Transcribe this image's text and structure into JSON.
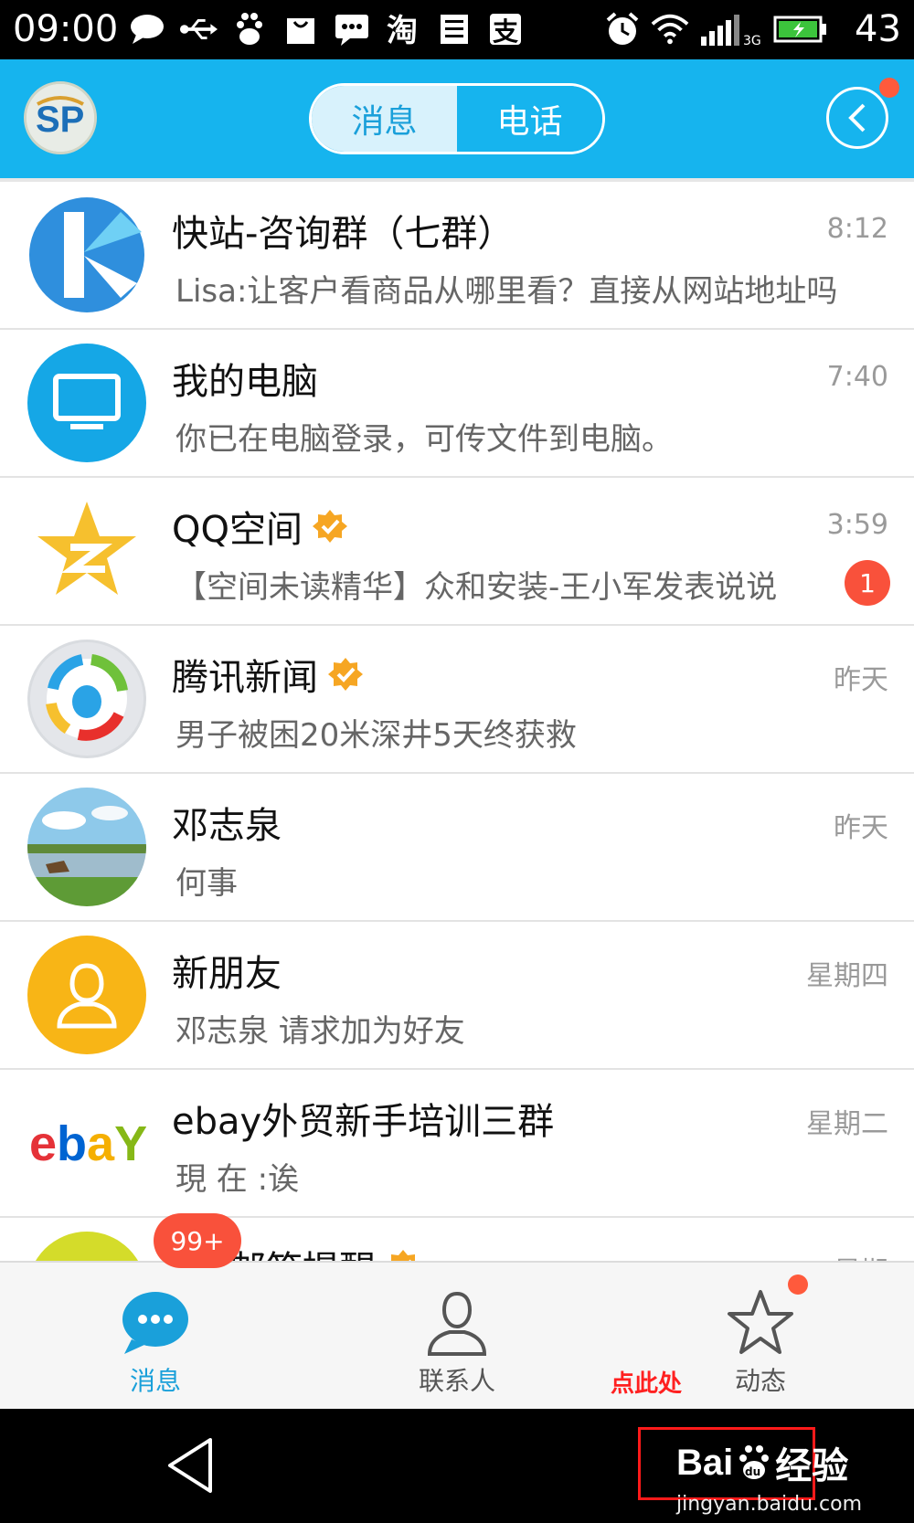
{
  "status_bar": {
    "time": "09:00",
    "battery_level": "43",
    "network": "3G",
    "left_icons": [
      "chat-bubble-icon",
      "usb-icon",
      "baidu-paw-icon",
      "bag-icon",
      "sms-icon",
      "taobao-icon",
      "contact-card-icon",
      "alipay-icon"
    ],
    "right_icons": [
      "alarm-icon",
      "wifi-icon",
      "signal-icon",
      "battery-icon"
    ]
  },
  "header": {
    "tabs": [
      {
        "label": "消息",
        "active": true
      },
      {
        "label": "电话",
        "active": false
      }
    ]
  },
  "conversations": [
    {
      "title": "快站-咨询群（七群）",
      "time": "8:12",
      "preview": "Lisa:让客户看商品从哪里看？直接从网站地址吗",
      "verified": false,
      "unread": "",
      "avatar": "kuaizhan-logo"
    },
    {
      "title": "我的电脑",
      "time": "7:40",
      "preview": "你已在电脑登录，可传文件到电脑。",
      "verified": false,
      "unread": "",
      "avatar": "computer-icon"
    },
    {
      "title": "QQ空间",
      "time": "3:59",
      "preview": "【空间未读精华】众和安装-王小军发表说说",
      "verified": true,
      "unread": "1",
      "avatar": "qzone-star-icon"
    },
    {
      "title": "腾讯新闻",
      "time": "昨天",
      "preview": "男子被困20米深井5天终获救",
      "verified": true,
      "unread": "",
      "avatar": "tencent-news-logo"
    },
    {
      "title": "邓志泉",
      "time": "昨天",
      "preview": "何事",
      "verified": false,
      "unread": "",
      "avatar": "landscape-photo"
    },
    {
      "title": "新朋友",
      "time": "星期四",
      "preview": "邓志泉 请求加为好友",
      "verified": false,
      "unread": "",
      "avatar": "person-icon"
    },
    {
      "title": "ebay外贸新手培训三群",
      "time": "星期二",
      "preview": "現 在 :诶",
      "verified": false,
      "unread": "",
      "avatar": "ebay-logo"
    },
    {
      "title": "QQ邮箱提醒",
      "time": "星期",
      "preview": "",
      "verified": true,
      "unread": "",
      "avatar": "qq-mail-icon"
    }
  ],
  "tabbar": {
    "tabs": [
      {
        "label": "消息",
        "active": true
      },
      {
        "label": "联系人",
        "active": false
      },
      {
        "label": "动态",
        "active": false
      }
    ],
    "messages_badge": "99+",
    "annotation": "点此处"
  },
  "watermark": {
    "logo_prefix": "Bai",
    "logo_du": "du",
    "logo_suffix": "经验",
    "url": "jingyan.baidu.com"
  },
  "colors": {
    "header_blue": "#16b4ee",
    "active_tab": "#1aa0da",
    "badge_red": "#f9513b",
    "verified_orange": "#f6a623"
  }
}
